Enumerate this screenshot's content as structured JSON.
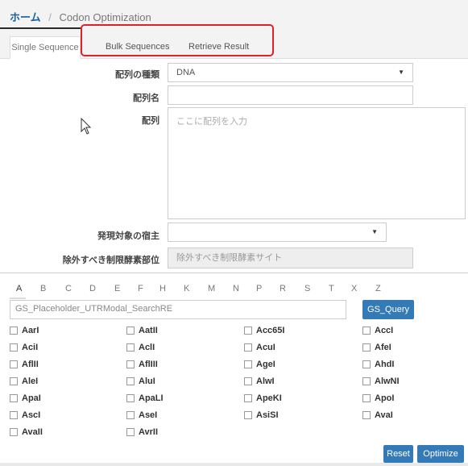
{
  "breadcrumb": {
    "home": "ホーム",
    "separator": "/",
    "current": "Codon Optimization"
  },
  "tabs": [
    {
      "label": "Single Sequence",
      "active": true
    },
    {
      "label": "Bulk Sequences",
      "active": false
    },
    {
      "label": "Retrieve Result",
      "active": false
    }
  ],
  "form": {
    "seq_type_label": "配列の種類",
    "seq_type_value": "DNA",
    "seq_name_label": "配列名",
    "seq_name_value": "",
    "seq_label": "配列",
    "seq_placeholder": "ここに配列を入力",
    "host_label": "発現対象の宿主",
    "host_value": "",
    "restriction_label": "除外すべき制限酵素部位",
    "restriction_placeholder": "除外すべき制限酵素サイト"
  },
  "alphabet": [
    "A",
    "B",
    "C",
    "D",
    "E",
    "F",
    "H",
    "K",
    "M",
    "N",
    "P",
    "R",
    "S",
    "T",
    "X",
    "Z"
  ],
  "search": {
    "value": "GS_Placeholder_UTRModal_SearchRE",
    "button": "GS_Query"
  },
  "enzymes": [
    [
      "AarI",
      "AatII",
      "Acc65I",
      "AccI"
    ],
    [
      "AciI",
      "AclI",
      "AcuI",
      "AfeI"
    ],
    [
      "AflII",
      "AflIII",
      "AgeI",
      "AhdI"
    ],
    [
      "AleI",
      "AluI",
      "AlwI",
      "AlwNI"
    ],
    [
      "ApaI",
      "ApaLI",
      "ApeKI",
      "ApoI"
    ],
    [
      "AscI",
      "AseI",
      "AsiSI",
      "AvaI"
    ],
    [
      "AvaII",
      "AvrII"
    ]
  ],
  "buttons": {
    "reset": "Reset",
    "optimize": "Optimize"
  },
  "colors": {
    "highlight": "#e0202b",
    "primary": "#337ab7",
    "link": "#1a5f9e"
  }
}
